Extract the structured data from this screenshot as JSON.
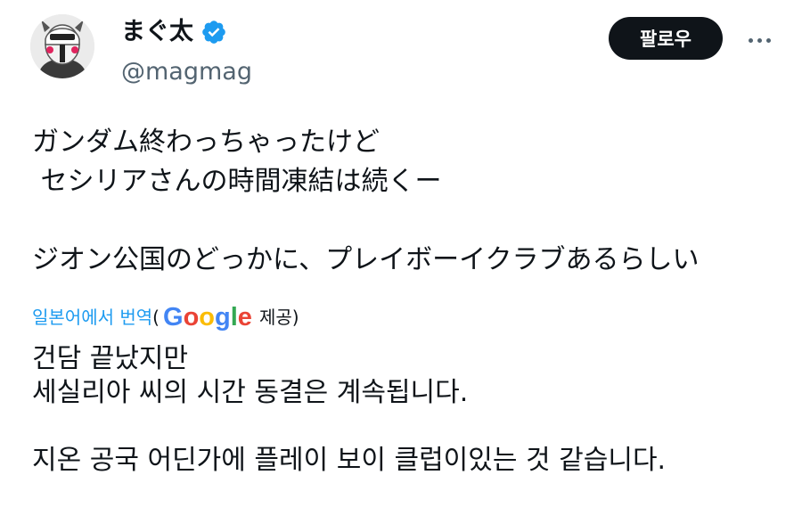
{
  "author": {
    "display_name": "まぐ太",
    "handle": "@magmag",
    "verified": true
  },
  "actions": {
    "follow_label": "팔로우"
  },
  "tweet": {
    "text": "ガンダム終わっちゃったけど\n セシリアさんの時間凍結は続くー\n\nジオン公国のどっかに、プレイボーイクラブあるらしい"
  },
  "translation": {
    "link_label": "일본어에서 번역",
    "open_paren": "(",
    "provider_logo": "Google",
    "provider_suffix": "제공)",
    "text": "건담 끝났지만\n세실리아 씨의 시간 동결은 계속됩니다.\n\n지온 공국 어딘가에 플레이 보이 클럽이있는 것 같습니다."
  },
  "colors": {
    "verified_blue": "#1d9bf0",
    "follow_bg": "#0f1419",
    "google_blue": "#4285F4",
    "google_red": "#EA4335",
    "google_yellow": "#FBBC05",
    "google_green": "#34A853"
  },
  "icons": [
    "avatar",
    "verified-badge-icon",
    "more-options-icon",
    "google-logo"
  ]
}
